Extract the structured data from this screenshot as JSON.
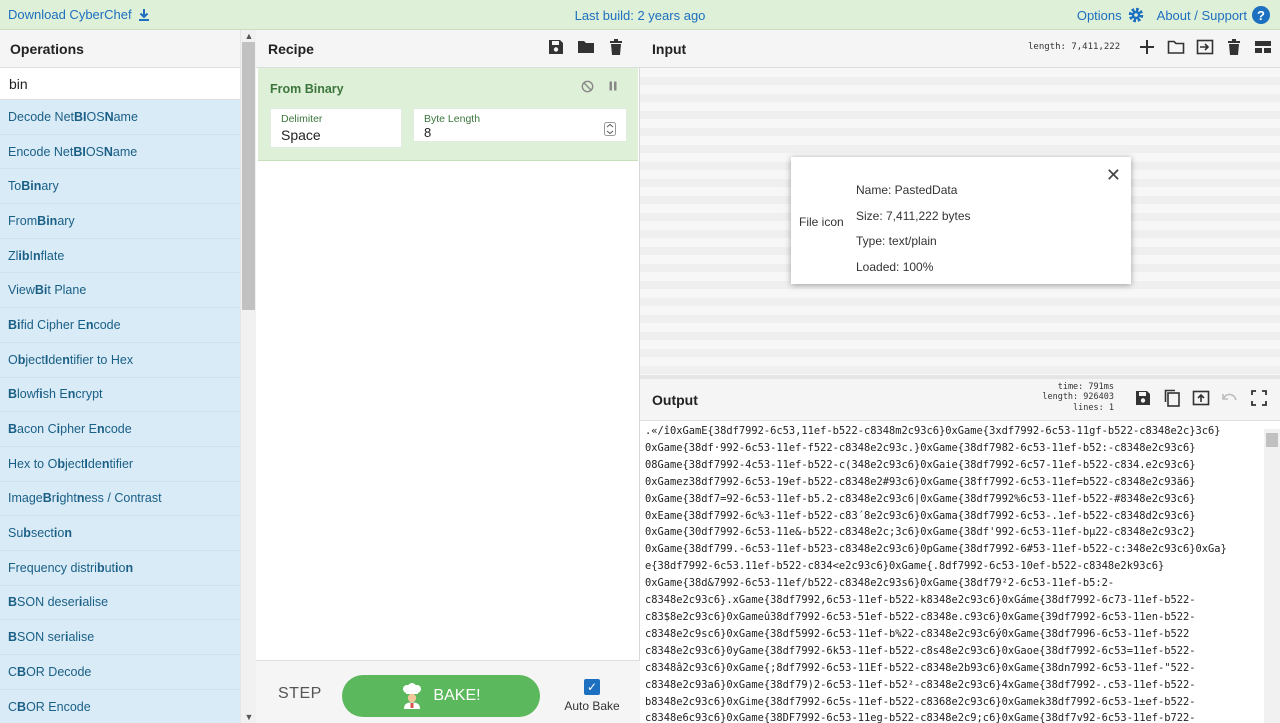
{
  "banner": {
    "download": "Download CyberChef",
    "last_build": "Last build: 2 years ago",
    "options": "Options",
    "about": "About / Support"
  },
  "operations": {
    "title": "Operations",
    "search_value": "bin",
    "items": [
      {
        "segments": [
          {
            "t": "Decode Net",
            "b": false
          },
          {
            "t": "BI",
            "b": true
          },
          {
            "t": "OS ",
            "b": false
          },
          {
            "t": "N",
            "b": true
          },
          {
            "t": "ame",
            "b": false
          }
        ]
      },
      {
        "segments": [
          {
            "t": "Encode Net",
            "b": false
          },
          {
            "t": "BI",
            "b": true
          },
          {
            "t": "OS ",
            "b": false
          },
          {
            "t": "N",
            "b": true
          },
          {
            "t": "ame",
            "b": false
          }
        ]
      },
      {
        "segments": [
          {
            "t": "To ",
            "b": false
          },
          {
            "t": "Bin",
            "b": true
          },
          {
            "t": "ary",
            "b": false
          }
        ]
      },
      {
        "segments": [
          {
            "t": "From ",
            "b": false
          },
          {
            "t": "Bin",
            "b": true
          },
          {
            "t": "ary",
            "b": false
          }
        ]
      },
      {
        "segments": [
          {
            "t": "Zl",
            "b": false
          },
          {
            "t": "ib",
            "b": true
          },
          {
            "t": " I",
            "b": false
          },
          {
            "t": "n",
            "b": true
          },
          {
            "t": "flate",
            "b": false
          }
        ]
      },
      {
        "segments": [
          {
            "t": "View ",
            "b": false
          },
          {
            "t": "Bi",
            "b": true
          },
          {
            "t": "t Plane",
            "b": false
          }
        ]
      },
      {
        "segments": [
          {
            "t": "Bi",
            "b": true
          },
          {
            "t": "fid Cipher E",
            "b": false
          },
          {
            "t": "n",
            "b": true
          },
          {
            "t": "code",
            "b": false
          }
        ]
      },
      {
        "segments": [
          {
            "t": "O",
            "b": false
          },
          {
            "t": "b",
            "b": true
          },
          {
            "t": "ject ",
            "b": false
          },
          {
            "t": "I",
            "b": true
          },
          {
            "t": "de",
            "b": false
          },
          {
            "t": "n",
            "b": true
          },
          {
            "t": "tifier to Hex",
            "b": false
          }
        ]
      },
      {
        "segments": [
          {
            "t": "B",
            "b": true
          },
          {
            "t": "lowf",
            "b": false
          },
          {
            "t": "i",
            "b": true
          },
          {
            "t": "sh E",
            "b": false
          },
          {
            "t": "n",
            "b": true
          },
          {
            "t": "crypt",
            "b": false
          }
        ]
      },
      {
        "segments": [
          {
            "t": "B",
            "b": true
          },
          {
            "t": "acon C",
            "b": false
          },
          {
            "t": "i",
            "b": true
          },
          {
            "t": "pher E",
            "b": false
          },
          {
            "t": "n",
            "b": true
          },
          {
            "t": "code",
            "b": false
          }
        ]
      },
      {
        "segments": [
          {
            "t": "Hex to O",
            "b": false
          },
          {
            "t": "b",
            "b": true
          },
          {
            "t": "ject ",
            "b": false
          },
          {
            "t": "I",
            "b": true
          },
          {
            "t": "de",
            "b": false
          },
          {
            "t": "n",
            "b": true
          },
          {
            "t": "tifier",
            "b": false
          }
        ]
      },
      {
        "segments": [
          {
            "t": "Image ",
            "b": false
          },
          {
            "t": "B",
            "b": true
          },
          {
            "t": "r",
            "b": false
          },
          {
            "t": "i",
            "b": true
          },
          {
            "t": "ght",
            "b": false
          },
          {
            "t": "n",
            "b": true
          },
          {
            "t": "ess / Contrast",
            "b": false
          }
        ]
      },
      {
        "segments": [
          {
            "t": "Su",
            "b": false
          },
          {
            "t": "b",
            "b": true
          },
          {
            "t": "sect",
            "b": false
          },
          {
            "t": "i",
            "b": true
          },
          {
            "t": "o",
            "b": false
          },
          {
            "t": "n",
            "b": true
          }
        ]
      },
      {
        "segments": [
          {
            "t": "Frequency distri",
            "b": false
          },
          {
            "t": "b",
            "b": true
          },
          {
            "t": "ut",
            "b": false
          },
          {
            "t": "i",
            "b": true
          },
          {
            "t": "o",
            "b": false
          },
          {
            "t": "n",
            "b": true
          }
        ]
      },
      {
        "segments": [
          {
            "t": "B",
            "b": true
          },
          {
            "t": "SON deser",
            "b": false
          },
          {
            "t": "i",
            "b": true
          },
          {
            "t": "alise",
            "b": false
          }
        ]
      },
      {
        "segments": [
          {
            "t": "B",
            "b": true
          },
          {
            "t": "SON ser",
            "b": false
          },
          {
            "t": "i",
            "b": true
          },
          {
            "t": "alise",
            "b": false
          }
        ]
      },
      {
        "segments": [
          {
            "t": "C",
            "b": false
          },
          {
            "t": "B",
            "b": true
          },
          {
            "t": "OR Decode",
            "b": false
          }
        ]
      },
      {
        "segments": [
          {
            "t": "C",
            "b": false
          },
          {
            "t": "B",
            "b": true
          },
          {
            "t": "OR Encode",
            "b": false
          }
        ]
      }
    ]
  },
  "recipe": {
    "title": "Recipe",
    "operation": {
      "name": "From Binary",
      "delimiter_label": "Delimiter",
      "delimiter_value": "Space",
      "byte_length_label": "Byte Length",
      "byte_length_value": "8"
    },
    "step_label": "STEP",
    "bake_label": "BAKE!",
    "auto_bake_label": "Auto Bake"
  },
  "input": {
    "title": "Input",
    "length": "length: 7,411,222",
    "file": {
      "icon_label": "File icon",
      "name": "Name: PastedData",
      "size": "Size: 7,411,222 bytes",
      "type": "Type: text/plain",
      "loaded": "Loaded: 100%"
    }
  },
  "output": {
    "title": "Output",
    "time": "time:   791ms",
    "length": "length: 926403",
    "lines": "lines:      1",
    "lines_text": [
      ".«/î0xGamE{38df7992-6c53,11ef-b522-c8348m2c93c6}0xGame{3xdf7992-6c53-11gf-b522-c8348e2c}3c6}",
      "0xGame{38df·992-6c53-11ef-f522-c8348e2c93c.}0xGame{38df7982-6c53-11ef-b52:-c8348e2c93c6}",
      "08Game{38df7992-4c53-11ef-b522-c(348e2c93c6}0xGaie{38df7992-6c57-11ef-b522-c834.e2c93c6}",
      "0xGamez38df7992-6c53-19ef-b522-c8348e2#93c6}0xGame{38ff7992-6c53-11ef=b522-c8348e2c93ä6}",
      "0xGame{38df7=92-6c53-11ef-b5.2-c8348e2c93c6|0xGame{38df7992%6c53-11ef-b522-#8348e2c93c6}",
      "0xEame{38df7992-6c%3-11ef-b522-c83´8e2c93c6}0xGama{38df7992-6c53-.1ef-b522-c8348d2c93c6}",
      "0xGame{30df7992-6c53-11e&-b522-c8348e2c;3c6}0xGame{38df'992-6c53-11ef-bµ22-c8348e2c93c2}",
      "0xGame{38df799.-6c53-11ef-b523-c8348e2c93c6}0pGame{38df7992-6#53-11ef-b522-c:348e2c93c6}0xGa}",
      "e{38df7992-6c53.11ef-b522-c834<e2c93c6}0xGame{.8df7992-6c53-10ef-b522-c8348e2k93c6}",
      "0xGame{38d&7992-6c53-11ef/b522-c8348e2c93s6}0xGame{38df79²2-6c53-11ef-b5:2-",
      "c8348e2c93c6}.xGame{38df7992,6c53-11ef-b522-k8348e2c93c6}0xGáme{38df7992-6c73-11ef-b522-",
      "c83$8e2c93c6}0xGameû38df7992-6c53-51ef-b522-c8348e.c93c6}0xGame{39df7992-6c53-11en-b522-",
      "c8348e2c9sc6}0xGame{38df5992-6c53-11ef-b%22-c8348e2c93c6ý0xGame{38df7996-6c53-11ef-b522",
      "c8348e2c93c6}0yGame{38df7992-6k53-11ef-b522-c8s48e2c93c6}0xGaoe{38df7992-6c53=11ef-b522-",
      "c8348â2c93c6}0xGame{;8df7992-6c53-11Ef-b522-c8348e2b93c6}0xGame{38dn7992-6c53-11ef-\"522-",
      "c8348e2c93a6}0xGame{38df79)2-6c53-11ef-b52²-c8348e2c93c6}4xGame{38df7992-.c53-11ef-b522-",
      "b8348e2c93c6}0xGime{38df7992-6c5s-11ef-b522-c8368e2c93c6}0xGamek38df7992-6c53-1±ef-b522-",
      "c8348e6c93c6}0xGame{38DF7992-6c53-11eg-b522-c8348e2c9;c6}0xGame{38df7v92-6c53-11ef-b722-"
    ]
  }
}
